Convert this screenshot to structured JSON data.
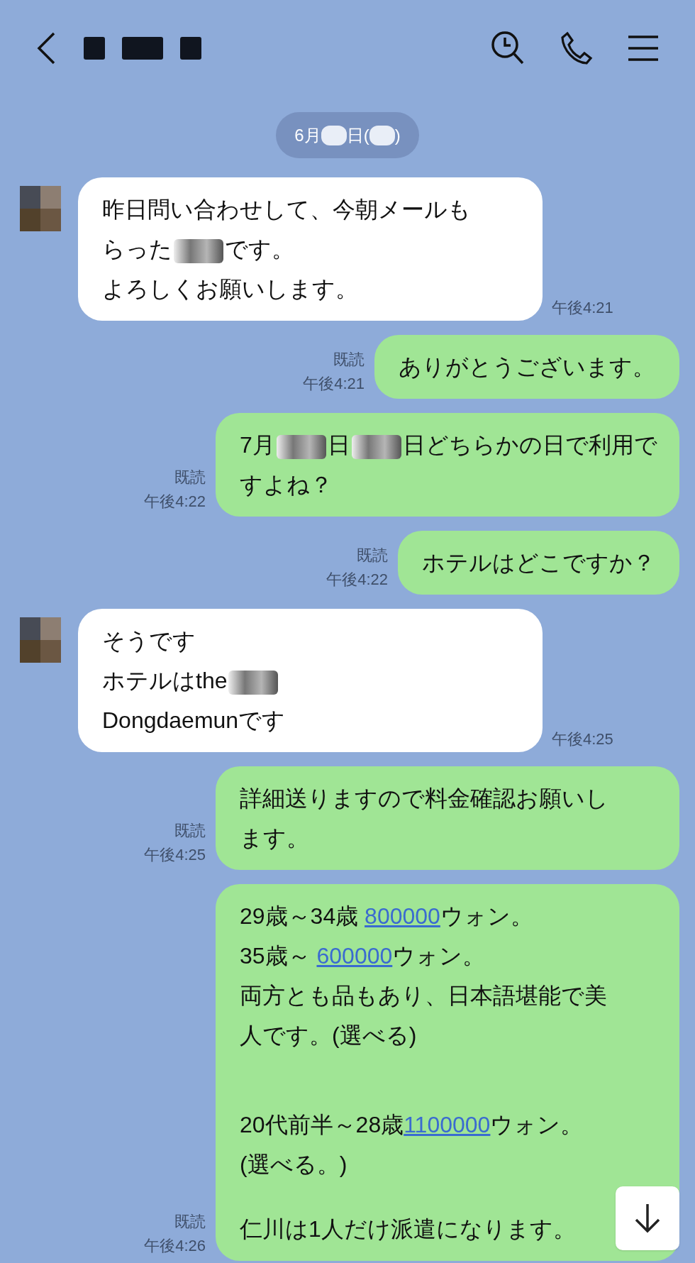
{
  "header": {
    "name_parts": [
      {
        "kind": "redacted"
      },
      {
        "kind": "redacted"
      },
      {
        "kind": "redacted"
      }
    ]
  },
  "date_pill": [
    {
      "kind": "text",
      "text": "6月"
    },
    {
      "kind": "redacted"
    },
    {
      "kind": "text",
      "text": "日("
    },
    {
      "kind": "redacted"
    },
    {
      "kind": "text",
      "text": ")"
    }
  ],
  "messages": [
    {
      "kind": "incoming",
      "time": "午後4:21",
      "lines": [
        {
          "kind": "text",
          "parts": [
            {
              "kind": "text",
              "text": "昨日問い合わせして、今朝メールも"
            }
          ]
        },
        {
          "kind": "text",
          "parts": [
            {
              "kind": "text",
              "text": "らった"
            },
            {
              "kind": "redacted"
            },
            {
              "kind": "text",
              "text": "です。"
            }
          ]
        },
        {
          "kind": "text",
          "parts": [
            {
              "kind": "text",
              "text": "よろしくお願いします。"
            }
          ]
        }
      ]
    },
    {
      "kind": "outgoing",
      "read": "既読",
      "time": "午後4:21",
      "lines": [
        {
          "kind": "text",
          "parts": [
            {
              "kind": "text",
              "text": "ありがとうございます。"
            }
          ]
        }
      ]
    },
    {
      "kind": "outgoing",
      "read": "既読",
      "time": "午後4:22",
      "lines": [
        {
          "kind": "text",
          "parts": [
            {
              "kind": "text",
              "text": "7月"
            },
            {
              "kind": "redacted"
            },
            {
              "kind": "text",
              "text": "日"
            },
            {
              "kind": "redacted"
            },
            {
              "kind": "text",
              "text": "日どちらかの日で利用で"
            }
          ]
        },
        {
          "kind": "text",
          "parts": [
            {
              "kind": "text",
              "text": "すよね？"
            }
          ]
        }
      ]
    },
    {
      "kind": "outgoing",
      "read": "既読",
      "time": "午後4:22",
      "lines": [
        {
          "kind": "text",
          "parts": [
            {
              "kind": "text",
              "text": "ホテルはどこですか？"
            }
          ]
        }
      ]
    },
    {
      "kind": "incoming",
      "time": "午後4:25",
      "lines": [
        {
          "kind": "text",
          "parts": [
            {
              "kind": "text",
              "text": "そうです"
            }
          ]
        },
        {
          "kind": "text",
          "parts": [
            {
              "kind": "text",
              "text": "ホテルはthe"
            },
            {
              "kind": "redacted"
            }
          ]
        },
        {
          "kind": "text",
          "parts": [
            {
              "kind": "text",
              "text": "Dongdaemunです"
            }
          ]
        }
      ]
    },
    {
      "kind": "outgoing",
      "read": "既読",
      "time": "午後4:25",
      "lines": [
        {
          "kind": "text",
          "parts": [
            {
              "kind": "text",
              "text": "詳細送りますので料金確認お願いし"
            }
          ]
        },
        {
          "kind": "text",
          "parts": [
            {
              "kind": "text",
              "text": "ます。"
            }
          ]
        }
      ]
    },
    {
      "kind": "outgoing",
      "read": "既読",
      "time": "午後4:26",
      "lines": [
        {
          "kind": "text",
          "parts": [
            {
              "kind": "text",
              "text": "29歳～34歳 "
            },
            {
              "kind": "link",
              "text": "800000"
            },
            {
              "kind": "text",
              "text": "ウォン。"
            }
          ]
        },
        {
          "kind": "text",
          "parts": [
            {
              "kind": "text",
              "text": "35歳～ "
            },
            {
              "kind": "link",
              "text": "600000"
            },
            {
              "kind": "text",
              "text": "ウォン。"
            }
          ]
        },
        {
          "kind": "text",
          "parts": [
            {
              "kind": "text",
              "text": "両方とも品もあり、日本語堪能で美"
            }
          ]
        },
        {
          "kind": "text",
          "parts": [
            {
              "kind": "text",
              "text": "人です。(選べる)"
            }
          ]
        },
        {
          "kind": "blank"
        },
        {
          "kind": "blank"
        },
        {
          "kind": "text",
          "parts": [
            {
              "kind": "text",
              "text": "20代前半～28歳"
            },
            {
              "kind": "link",
              "text": "1100000"
            },
            {
              "kind": "text",
              "text": "ウォン。"
            }
          ]
        },
        {
          "kind": "text",
          "parts": [
            {
              "kind": "text",
              "text": "(選べる。)"
            }
          ]
        },
        {
          "kind": "blank"
        },
        {
          "kind": "text",
          "parts": [
            {
              "kind": "text",
              "text": "仁川は1人だけ派遣になります。"
            }
          ]
        }
      ]
    }
  ]
}
